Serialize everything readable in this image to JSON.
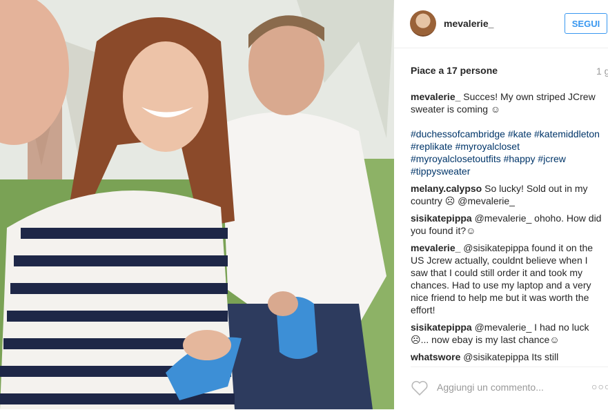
{
  "post": {
    "username": "mevalerie_",
    "follow_label": "SEGUI",
    "likes": "Piace a 17 persone",
    "time": "1 g"
  },
  "comments": [
    {
      "user": "mevalerie_",
      "text": "Succes! My own striped JCrew sweater is coming ☺"
    },
    {
      "user": "melany.calypso",
      "text": "So lucky! Sold out in my country ☹ @mevalerie_"
    },
    {
      "user": "sisikatepippa",
      "text": "@mevalerie_ ohoho. How did you found it?☺"
    },
    {
      "user": "mevalerie_",
      "text": "@sisikatepippa found it on the US Jcrew actually, couldnt believe when I saw that I could still order it and took my chances. Had to use my laptop and a very nice friend to help me but it was worth the effort!"
    },
    {
      "user": "sisikatepippa",
      "text": "@mevalerie_ I had no luck ☹... now ebay is my last chance☺"
    },
    {
      "user": "whatswore",
      "text": "@sisikatepippa Its still"
    }
  ],
  "hashtags": "#duchessofcambridge #kate #katemiddleton #replikate #myroyalcloset #myroyalclosetoutfits #happy #jcrew #tippysweater",
  "footer": {
    "placeholder": "Aggiungi un commento...",
    "more": "○○○"
  },
  "colors": {
    "link": "#003569",
    "accent": "#3897f0"
  }
}
